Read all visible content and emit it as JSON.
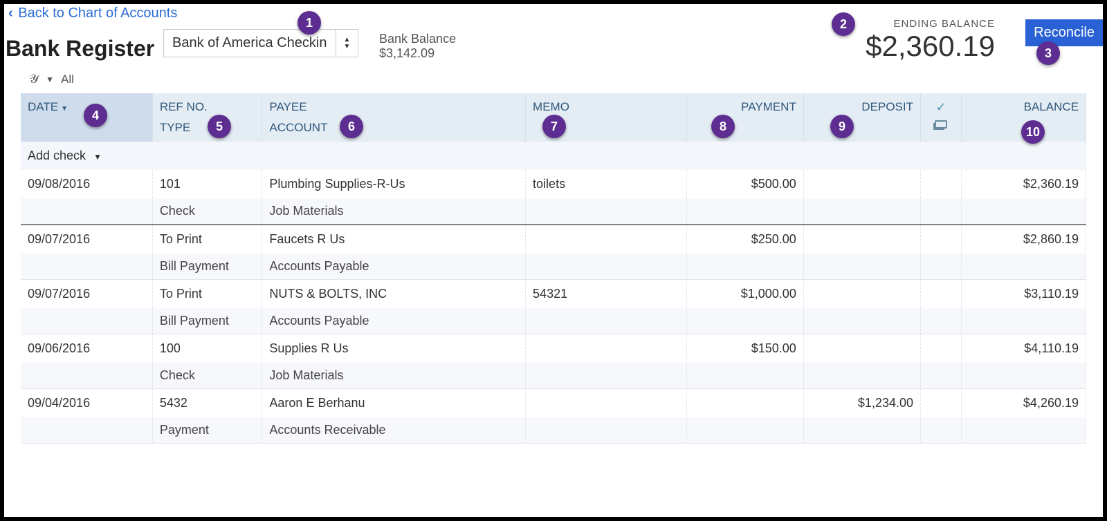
{
  "nav": {
    "back_label": "Back to Chart of Accounts"
  },
  "page": {
    "title": "Bank Register"
  },
  "account_select": {
    "selected": "Bank of America Checkin"
  },
  "bank_balance": {
    "label": "Bank Balance",
    "value": "$3,142.09"
  },
  "ending_balance": {
    "label": "ENDING BALANCE",
    "value": "$2,360.19"
  },
  "actions": {
    "reconcile": "Reconcile"
  },
  "filter": {
    "text": "All"
  },
  "columns": {
    "date": "DATE",
    "refno": "REF NO.",
    "type": "TYPE",
    "payee": "PAYEE",
    "account": "ACCOUNT",
    "memo": "MEMO",
    "payment": "PAYMENT",
    "deposit": "DEPOSIT",
    "balance": "BALANCE"
  },
  "addrow": {
    "label": "Add check"
  },
  "callouts": [
    "1",
    "2",
    "3",
    "4",
    "5",
    "6",
    "7",
    "8",
    "9",
    "10"
  ],
  "rows": [
    {
      "date": "09/08/2016",
      "ref": "101",
      "type": "Check",
      "payee": "Plumbing Supplies-R-Us",
      "account": "Job Materials",
      "memo": "toilets",
      "payment": "$500.00",
      "deposit": "",
      "balance": "$2,360.19"
    },
    {
      "date": "09/07/2016",
      "ref": "To Print",
      "type": "Bill Payment",
      "payee": "Faucets R Us",
      "account": "Accounts Payable",
      "memo": "",
      "payment": "$250.00",
      "deposit": "",
      "balance": "$2,860.19"
    },
    {
      "date": "09/07/2016",
      "ref": "To Print",
      "type": "Bill Payment",
      "payee": "NUTS & BOLTS, INC",
      "account": "Accounts Payable",
      "memo": "54321",
      "payment": "$1,000.00",
      "deposit": "",
      "balance": "$3,110.19"
    },
    {
      "date": "09/06/2016",
      "ref": "100",
      "type": "Check",
      "payee": "Supplies R Us",
      "account": "Job Materials",
      "memo": "",
      "payment": "$150.00",
      "deposit": "",
      "balance": "$4,110.19"
    },
    {
      "date": "09/04/2016",
      "ref": "5432",
      "type": "Payment",
      "payee": "Aaron E Berhanu",
      "account": "Accounts Receivable",
      "memo": "",
      "payment": "",
      "deposit": "$1,234.00",
      "balance": "$4,260.19"
    }
  ]
}
